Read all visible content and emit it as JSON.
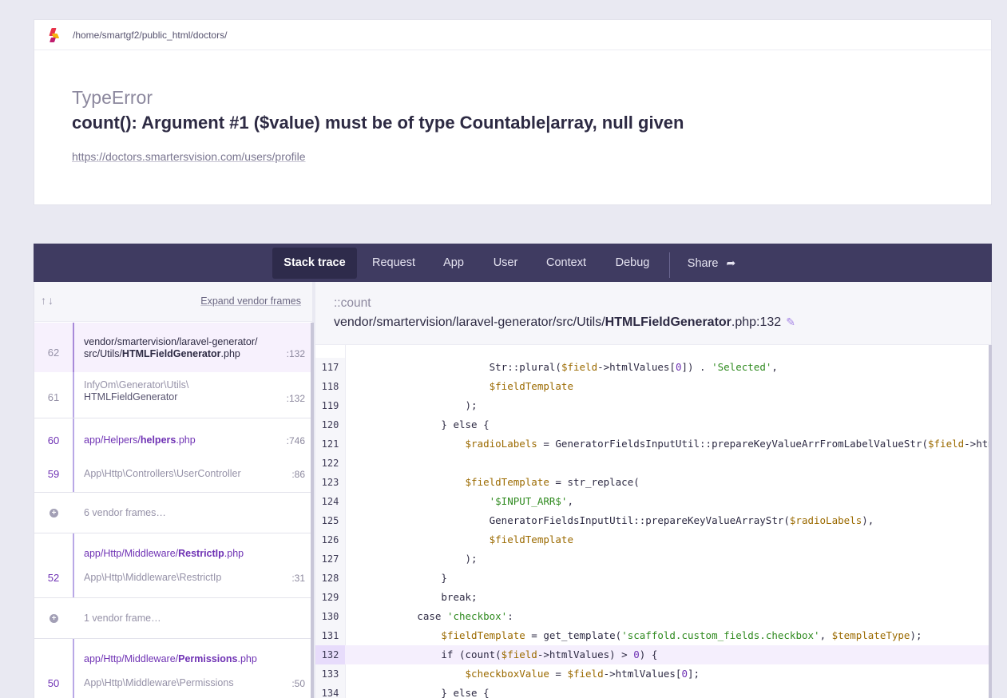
{
  "header": {
    "path": "/home/smartgf2/public_html/doctors/",
    "error_class": "TypeError",
    "error_message": "count(): Argument #1 ($value) must be of type Countable|array, null given",
    "url": "https://doctors.smartersvision.com/users/profile"
  },
  "tabs": [
    {
      "label": "Stack trace",
      "active": true
    },
    {
      "label": "Request"
    },
    {
      "label": "App"
    },
    {
      "label": "User"
    },
    {
      "label": "Context"
    },
    {
      "label": "Debug"
    },
    {
      "label": "Share"
    }
  ],
  "frames_panel": {
    "expand_label": "Expand vendor frames",
    "frames": [
      {
        "num": "62",
        "line": ":132",
        "path_prefix": "vendor/smartervision/laravel-generator/",
        "path_dir": "src/Utils/",
        "path_file": "HTMLFieldGenerator",
        "path_ext": ".php"
      },
      {
        "num": "61",
        "line": ":132",
        "ns": "InfyOm\\Generator\\Utils\\",
        "cls": "HTMLFieldGenerator"
      },
      {
        "num": "60",
        "line": ":746",
        "path_dir": "app/Helpers/",
        "path_file": "helpers",
        "path_ext": ".php"
      },
      {
        "num": "59",
        "line": ":86",
        "ns": "App\\Http\\Controllers\\",
        "cls": "UserController"
      },
      {
        "collapsed": "6 vendor frames…"
      },
      {
        "path_dir": "app/Http/Middleware/",
        "path_file": "RestrictIp",
        "path_ext": ".php"
      },
      {
        "num": "52",
        "line": ":31",
        "ns": "App\\Http\\Middleware\\",
        "cls": "RestrictIp"
      },
      {
        "collapsed": "1 vendor frame…"
      },
      {
        "path_dir": "app/Http/Middleware/",
        "path_file": "Permissions",
        "path_ext": ".php"
      },
      {
        "num": "50",
        "line": ":50",
        "ns": "App\\Http\\Middleware\\",
        "cls": "Permissions"
      }
    ]
  },
  "code_panel": {
    "method": "::count",
    "file_prefix": "vendor/smartervision/laravel-generator/src/Utils/",
    "file_name": "HTMLFieldGenerator",
    "file_suffix": ".php:132",
    "highlight_line": "132",
    "lines": [
      {
        "n": "117",
        "code": "                        Str::plural($field->htmlValues[0]) . 'Selected',"
      },
      {
        "n": "118",
        "code": "                        $fieldTemplate"
      },
      {
        "n": "119",
        "code": "                    );"
      },
      {
        "n": "120",
        "code": "                } else {"
      },
      {
        "n": "121",
        "code": "                    $radioLabels = GeneratorFieldsInputUtil::prepareKeyValueArrFromLabelValueStr($field->htmlValues);"
      },
      {
        "n": "122",
        "code": ""
      },
      {
        "n": "123",
        "code": "                    $fieldTemplate = str_replace("
      },
      {
        "n": "124",
        "code": "                        '$INPUT_ARR$',"
      },
      {
        "n": "125",
        "code": "                        GeneratorFieldsInputUtil::prepareKeyValueArrayStr($radioLabels),"
      },
      {
        "n": "126",
        "code": "                        $fieldTemplate"
      },
      {
        "n": "127",
        "code": "                    );"
      },
      {
        "n": "128",
        "code": "                }"
      },
      {
        "n": "129",
        "code": "                break;"
      },
      {
        "n": "130",
        "code": "            case 'checkbox':"
      },
      {
        "n": "131",
        "code": "                $fieldTemplate = get_template('scaffold.custom_fields.checkbox', $templateType);"
      },
      {
        "n": "132",
        "code": "                if (count($field->htmlValues) > 0) {"
      },
      {
        "n": "133",
        "code": "                    $checkboxValue = $field->htmlValues[0];"
      },
      {
        "n": "134",
        "code": "                } else {"
      }
    ]
  },
  "colors": {
    "accent": "#6f32b4",
    "tabbar": "#3f3b61",
    "background": "#e9e9f2"
  }
}
